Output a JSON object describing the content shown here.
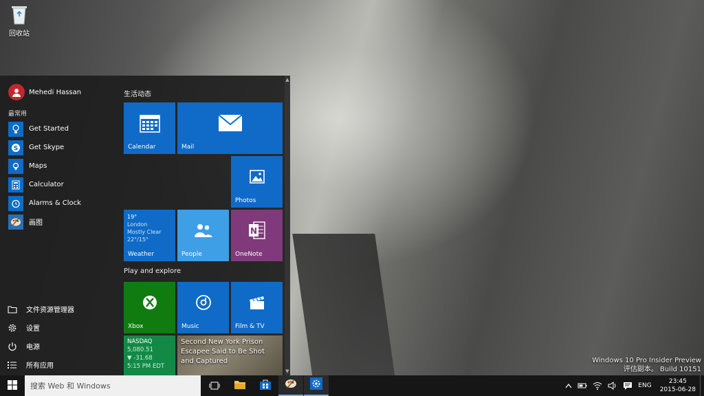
{
  "desktop": {
    "recycle_bin_label": "回收站",
    "watermark_line1": "Windows 10 Pro Insider Preview",
    "watermark_line2": "评估副本。 Build 10151"
  },
  "start_menu": {
    "user_name": "Mehedi Hassan",
    "most_used_label": "最常用",
    "most_used": [
      {
        "label": "Get Started",
        "icon": "lightbulb-icon"
      },
      {
        "label": "Get Skype",
        "icon": "skype-icon"
      },
      {
        "label": "Maps",
        "icon": "maps-icon"
      },
      {
        "label": "Calculator",
        "icon": "calculator-icon"
      },
      {
        "label": "Alarms & Clock",
        "icon": "alarm-clock-icon"
      },
      {
        "label": "画图",
        "icon": "paint-icon"
      }
    ],
    "bottom_items": [
      {
        "label": "文件资源管理器",
        "icon": "folder-icon"
      },
      {
        "label": "设置",
        "icon": "gear-icon"
      },
      {
        "label": "电源",
        "icon": "power-icon"
      },
      {
        "label": "所有应用",
        "icon": "all-apps-icon"
      }
    ],
    "group1_title": "生活动态",
    "group2_title": "Play and explore",
    "tiles": {
      "calendar": "Calendar",
      "mail": "Mail",
      "photos": "Photos",
      "weather": {
        "label": "Weather",
        "temp": "19°",
        "city": "London",
        "condition": "Mostly Clear",
        "range": "22°/15°"
      },
      "people": "People",
      "onenote": "OneNote",
      "xbox": "Xbox",
      "music": "Music",
      "film": "Film & TV",
      "finance": {
        "index": "NASDAQ",
        "value": "5,080.51",
        "change": "▼ -31.68",
        "time": "5:15 PM EDT"
      },
      "news": "Second New York Prison Escapee Said to Be Shot and Captured"
    }
  },
  "taskbar": {
    "search_placeholder": "搜索 Web 和 Windows",
    "language": "ENG",
    "time": "23:45",
    "date": "2015-06-28"
  },
  "colors": {
    "accent": "#0f6bc7",
    "tile_blue": "#0f6bc7",
    "tile_light_blue": "#3e9ee6",
    "onenote_purple": "#80397b",
    "xbox_green": "#107c10",
    "finance_green": "#128a46"
  }
}
